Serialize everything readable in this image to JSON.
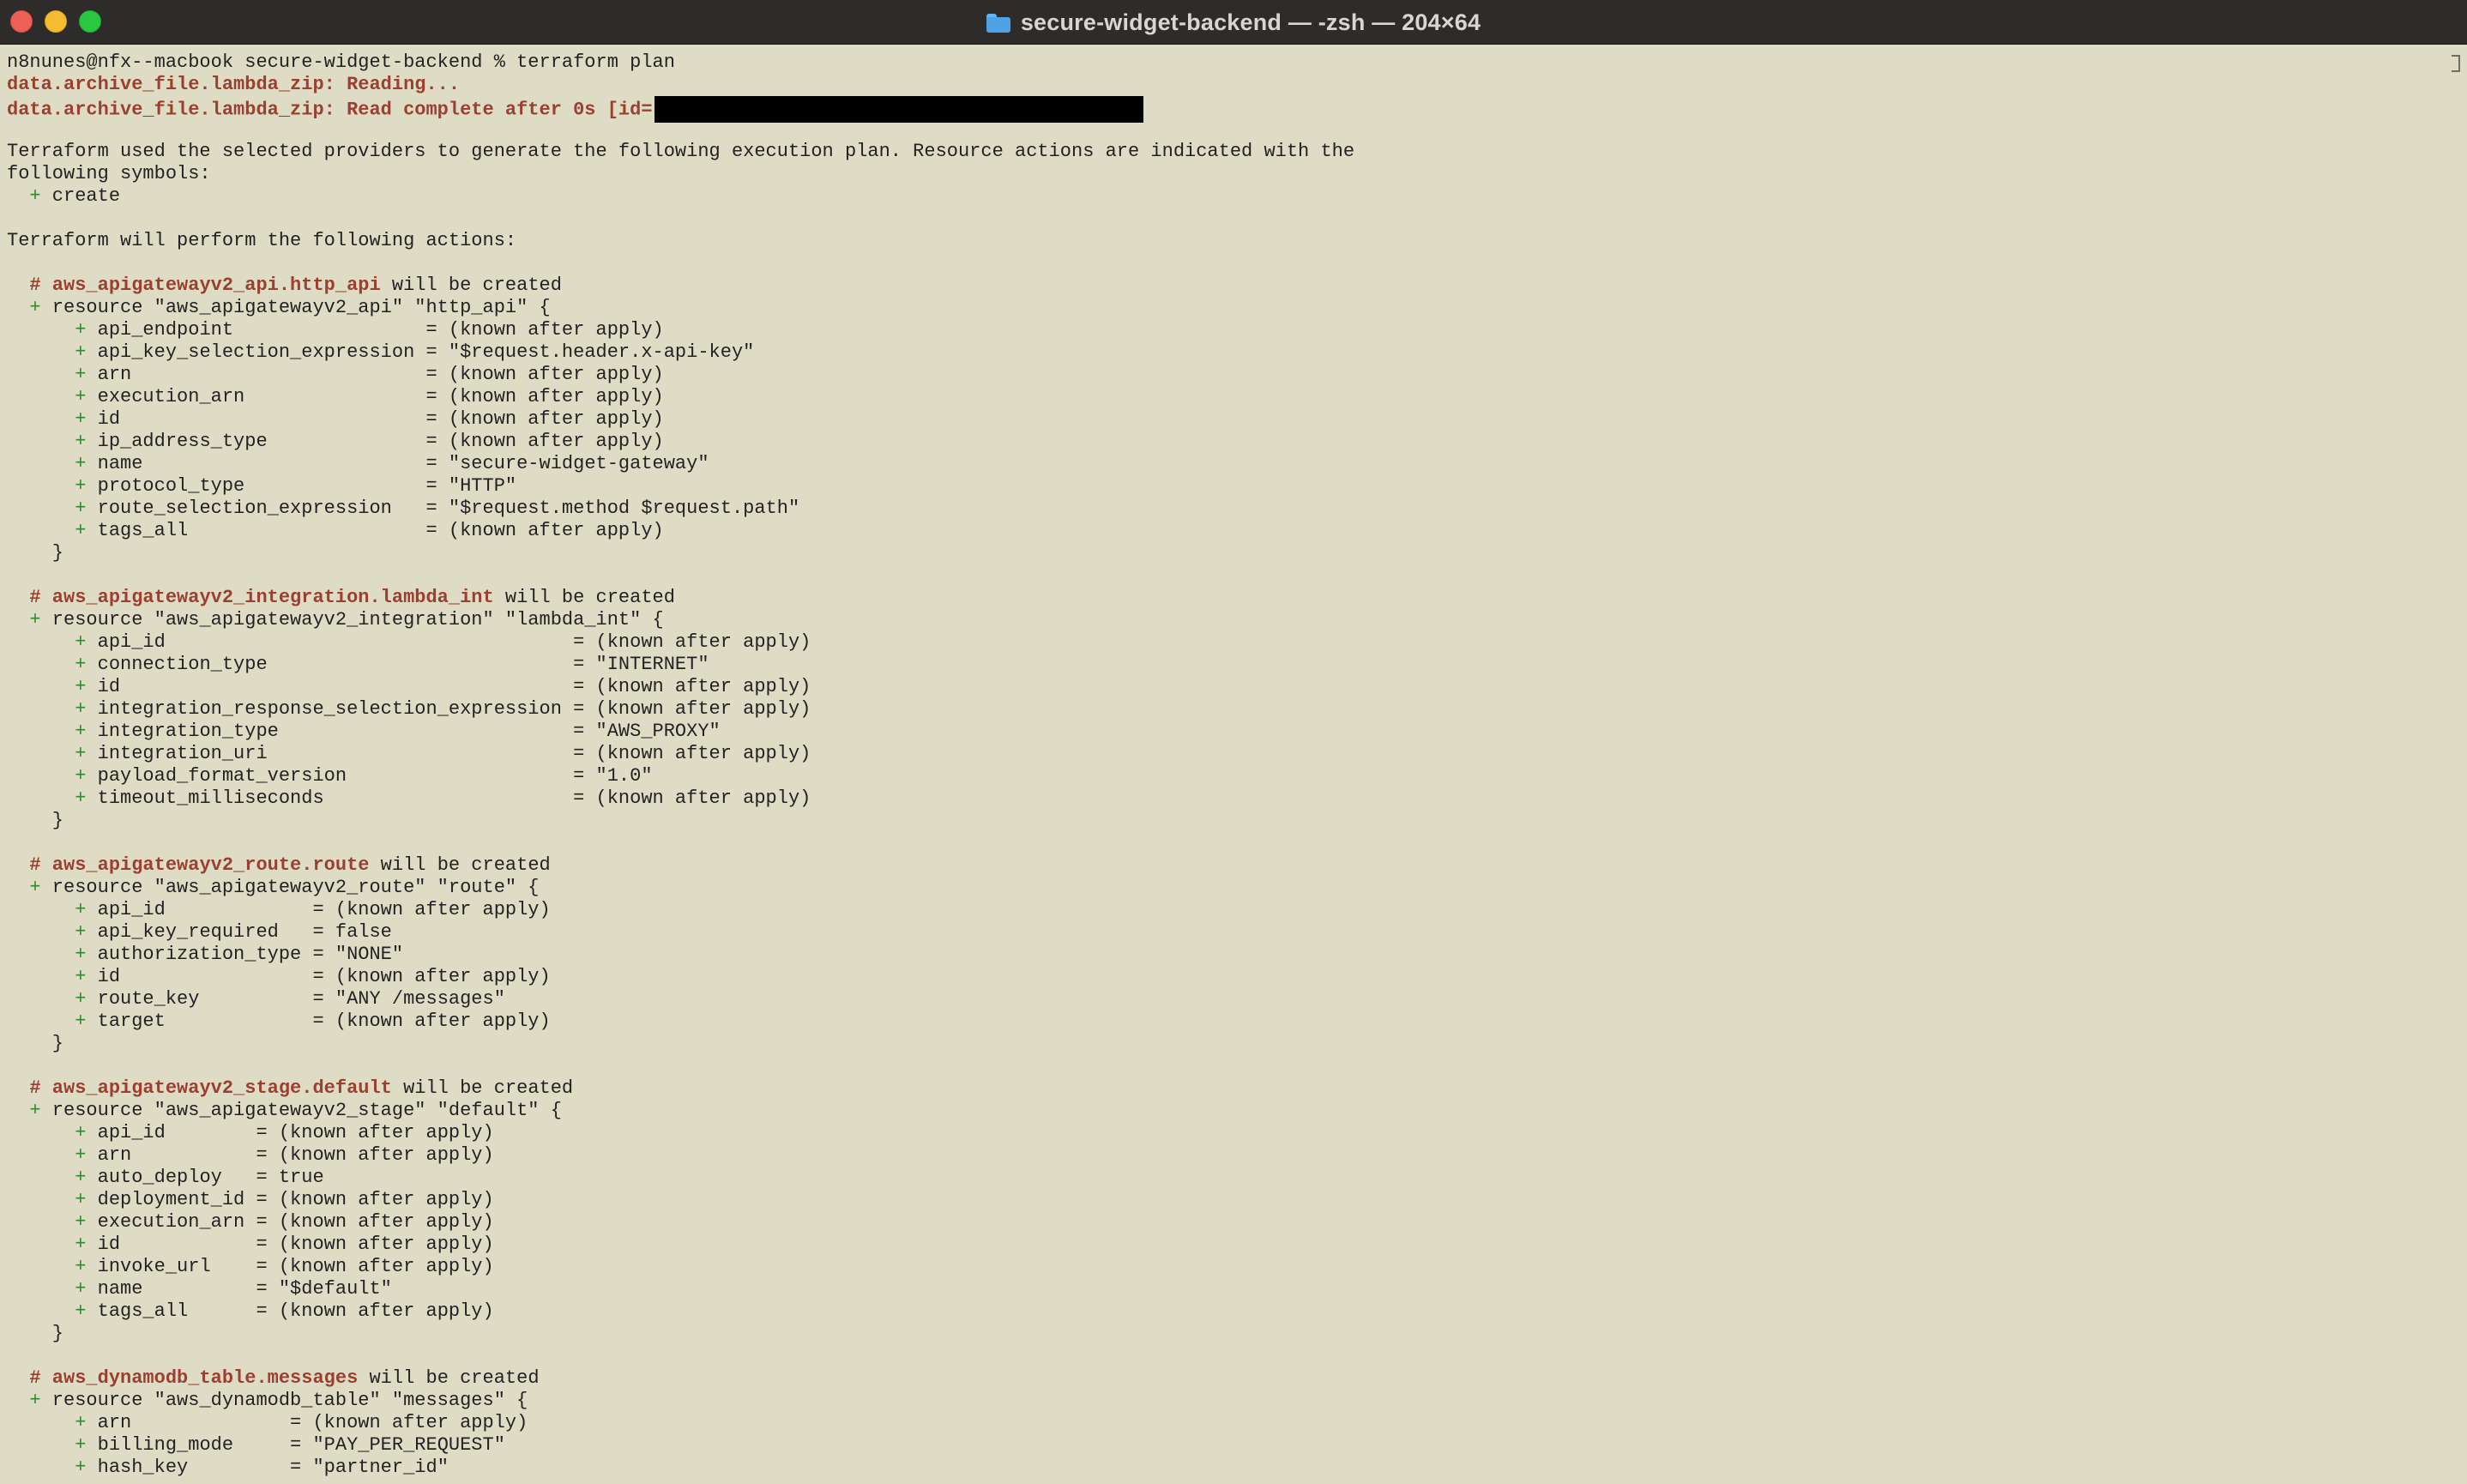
{
  "window": {
    "title": "secure-widget-backend — -zsh — 204×64",
    "icon": "folder-icon"
  },
  "terminal": {
    "lines": [
      {
        "parts": [
          {
            "text": "n8nunes@nfx--macbook secure-widget-backend % terraform plan"
          }
        ]
      },
      {
        "parts": [
          {
            "text": "data.archive_file.lambda_zip: Reading...",
            "class": "bold red"
          }
        ]
      },
      {
        "parts": [
          {
            "text": "data.archive_file.lambda_zip: Read complete after 0s [id=",
            "class": "bold red"
          },
          {
            "type": "redaction"
          }
        ]
      },
      {
        "parts": [
          {
            "text": ""
          }
        ]
      },
      {
        "parts": [
          {
            "text": "Terraform used the selected providers to generate the following execution plan. Resource actions are indicated with the"
          }
        ]
      },
      {
        "parts": [
          {
            "text": "following symbols:"
          }
        ]
      },
      {
        "parts": [
          {
            "text": "  "
          },
          {
            "text": "+",
            "class": "green"
          },
          {
            "text": " create"
          }
        ]
      },
      {
        "parts": [
          {
            "text": ""
          }
        ]
      },
      {
        "parts": [
          {
            "text": "Terraform will perform the following actions:"
          }
        ]
      },
      {
        "parts": [
          {
            "text": ""
          }
        ]
      },
      {
        "parts": [
          {
            "text": "  "
          },
          {
            "text": "#",
            "class": "bold red"
          },
          {
            "text": " aws_apigatewayv2_api.http_api",
            "class": "bold red"
          },
          {
            "text": " will be created"
          }
        ]
      },
      {
        "parts": [
          {
            "text": "  "
          },
          {
            "text": "+",
            "class": "green"
          },
          {
            "text": " resource \"aws_apigatewayv2_api\" \"http_api\" {"
          }
        ]
      },
      {
        "parts": [
          {
            "text": "      "
          },
          {
            "text": "+",
            "class": "green"
          },
          {
            "text": " api_endpoint                 = (known after apply)"
          }
        ]
      },
      {
        "parts": [
          {
            "text": "      "
          },
          {
            "text": "+",
            "class": "green"
          },
          {
            "text": " api_key_selection_expression = \"$request.header.x-api-key\""
          }
        ]
      },
      {
        "parts": [
          {
            "text": "      "
          },
          {
            "text": "+",
            "class": "green"
          },
          {
            "text": " arn                          = (known after apply)"
          }
        ]
      },
      {
        "parts": [
          {
            "text": "      "
          },
          {
            "text": "+",
            "class": "green"
          },
          {
            "text": " execution_arn                = (known after apply)"
          }
        ]
      },
      {
        "parts": [
          {
            "text": "      "
          },
          {
            "text": "+",
            "class": "green"
          },
          {
            "text": " id                           = (known after apply)"
          }
        ]
      },
      {
        "parts": [
          {
            "text": "      "
          },
          {
            "text": "+",
            "class": "green"
          },
          {
            "text": " ip_address_type              = (known after apply)"
          }
        ]
      },
      {
        "parts": [
          {
            "text": "      "
          },
          {
            "text": "+",
            "class": "green"
          },
          {
            "text": " name                         = \"secure-widget-gateway\""
          }
        ]
      },
      {
        "parts": [
          {
            "text": "      "
          },
          {
            "text": "+",
            "class": "green"
          },
          {
            "text": " protocol_type                = \"HTTP\""
          }
        ]
      },
      {
        "parts": [
          {
            "text": "      "
          },
          {
            "text": "+",
            "class": "green"
          },
          {
            "text": " route_selection_expression   = \"$request.method $request.path\""
          }
        ]
      },
      {
        "parts": [
          {
            "text": "      "
          },
          {
            "text": "+",
            "class": "green"
          },
          {
            "text": " tags_all                     = (known after apply)"
          }
        ]
      },
      {
        "parts": [
          {
            "text": "    }"
          }
        ]
      },
      {
        "parts": [
          {
            "text": ""
          }
        ]
      },
      {
        "parts": [
          {
            "text": "  "
          },
          {
            "text": "#",
            "class": "bold red"
          },
          {
            "text": " aws_apigatewayv2_integration.lambda_int",
            "class": "bold red"
          },
          {
            "text": " will be created"
          }
        ]
      },
      {
        "parts": [
          {
            "text": "  "
          },
          {
            "text": "+",
            "class": "green"
          },
          {
            "text": " resource \"aws_apigatewayv2_integration\" \"lambda_int\" {"
          }
        ]
      },
      {
        "parts": [
          {
            "text": "      "
          },
          {
            "text": "+",
            "class": "green"
          },
          {
            "text": " api_id                                    = (known after apply)"
          }
        ]
      },
      {
        "parts": [
          {
            "text": "      "
          },
          {
            "text": "+",
            "class": "green"
          },
          {
            "text": " connection_type                           = \"INTERNET\""
          }
        ]
      },
      {
        "parts": [
          {
            "text": "      "
          },
          {
            "text": "+",
            "class": "green"
          },
          {
            "text": " id                                        = (known after apply)"
          }
        ]
      },
      {
        "parts": [
          {
            "text": "      "
          },
          {
            "text": "+",
            "class": "green"
          },
          {
            "text": " integration_response_selection_expression = (known after apply)"
          }
        ]
      },
      {
        "parts": [
          {
            "text": "      "
          },
          {
            "text": "+",
            "class": "green"
          },
          {
            "text": " integration_type                          = \"AWS_PROXY\""
          }
        ]
      },
      {
        "parts": [
          {
            "text": "      "
          },
          {
            "text": "+",
            "class": "green"
          },
          {
            "text": " integration_uri                           = (known after apply)"
          }
        ]
      },
      {
        "parts": [
          {
            "text": "      "
          },
          {
            "text": "+",
            "class": "green"
          },
          {
            "text": " payload_format_version                    = \"1.0\""
          }
        ]
      },
      {
        "parts": [
          {
            "text": "      "
          },
          {
            "text": "+",
            "class": "green"
          },
          {
            "text": " timeout_milliseconds                      = (known after apply)"
          }
        ]
      },
      {
        "parts": [
          {
            "text": "    }"
          }
        ]
      },
      {
        "parts": [
          {
            "text": ""
          }
        ]
      },
      {
        "parts": [
          {
            "text": "  "
          },
          {
            "text": "#",
            "class": "bold red"
          },
          {
            "text": " aws_apigatewayv2_route.route",
            "class": "bold red"
          },
          {
            "text": " will be created"
          }
        ]
      },
      {
        "parts": [
          {
            "text": "  "
          },
          {
            "text": "+",
            "class": "green"
          },
          {
            "text": " resource \"aws_apigatewayv2_route\" \"route\" {"
          }
        ]
      },
      {
        "parts": [
          {
            "text": "      "
          },
          {
            "text": "+",
            "class": "green"
          },
          {
            "text": " api_id             = (known after apply)"
          }
        ]
      },
      {
        "parts": [
          {
            "text": "      "
          },
          {
            "text": "+",
            "class": "green"
          },
          {
            "text": " api_key_required   = false"
          }
        ]
      },
      {
        "parts": [
          {
            "text": "      "
          },
          {
            "text": "+",
            "class": "green"
          },
          {
            "text": " authorization_type = \"NONE\""
          }
        ]
      },
      {
        "parts": [
          {
            "text": "      "
          },
          {
            "text": "+",
            "class": "green"
          },
          {
            "text": " id                 = (known after apply)"
          }
        ]
      },
      {
        "parts": [
          {
            "text": "      "
          },
          {
            "text": "+",
            "class": "green"
          },
          {
            "text": " route_key          = \"ANY /messages\""
          }
        ]
      },
      {
        "parts": [
          {
            "text": "      "
          },
          {
            "text": "+",
            "class": "green"
          },
          {
            "text": " target             = (known after apply)"
          }
        ]
      },
      {
        "parts": [
          {
            "text": "    }"
          }
        ]
      },
      {
        "parts": [
          {
            "text": ""
          }
        ]
      },
      {
        "parts": [
          {
            "text": "  "
          },
          {
            "text": "#",
            "class": "bold red"
          },
          {
            "text": " aws_apigatewayv2_stage.default",
            "class": "bold red"
          },
          {
            "text": " will be created"
          }
        ]
      },
      {
        "parts": [
          {
            "text": "  "
          },
          {
            "text": "+",
            "class": "green"
          },
          {
            "text": " resource \"aws_apigatewayv2_stage\" \"default\" {"
          }
        ]
      },
      {
        "parts": [
          {
            "text": "      "
          },
          {
            "text": "+",
            "class": "green"
          },
          {
            "text": " api_id        = (known after apply)"
          }
        ]
      },
      {
        "parts": [
          {
            "text": "      "
          },
          {
            "text": "+",
            "class": "green"
          },
          {
            "text": " arn           = (known after apply)"
          }
        ]
      },
      {
        "parts": [
          {
            "text": "      "
          },
          {
            "text": "+",
            "class": "green"
          },
          {
            "text": " auto_deploy   = true"
          }
        ]
      },
      {
        "parts": [
          {
            "text": "      "
          },
          {
            "text": "+",
            "class": "green"
          },
          {
            "text": " deployment_id = (known after apply)"
          }
        ]
      },
      {
        "parts": [
          {
            "text": "      "
          },
          {
            "text": "+",
            "class": "green"
          },
          {
            "text": " execution_arn = (known after apply)"
          }
        ]
      },
      {
        "parts": [
          {
            "text": "      "
          },
          {
            "text": "+",
            "class": "green"
          },
          {
            "text": " id            = (known after apply)"
          }
        ]
      },
      {
        "parts": [
          {
            "text": "      "
          },
          {
            "text": "+",
            "class": "green"
          },
          {
            "text": " invoke_url    = (known after apply)"
          }
        ]
      },
      {
        "parts": [
          {
            "text": "      "
          },
          {
            "text": "+",
            "class": "green"
          },
          {
            "text": " name          = \"$default\""
          }
        ]
      },
      {
        "parts": [
          {
            "text": "      "
          },
          {
            "text": "+",
            "class": "green"
          },
          {
            "text": " tags_all      = (known after apply)"
          }
        ]
      },
      {
        "parts": [
          {
            "text": "    }"
          }
        ]
      },
      {
        "parts": [
          {
            "text": ""
          }
        ]
      },
      {
        "parts": [
          {
            "text": "  "
          },
          {
            "text": "#",
            "class": "bold red"
          },
          {
            "text": " aws_dynamodb_table.messages",
            "class": "bold red"
          },
          {
            "text": " will be created"
          }
        ]
      },
      {
        "parts": [
          {
            "text": "  "
          },
          {
            "text": "+",
            "class": "green"
          },
          {
            "text": " resource \"aws_dynamodb_table\" \"messages\" {"
          }
        ]
      },
      {
        "parts": [
          {
            "text": "      "
          },
          {
            "text": "+",
            "class": "green"
          },
          {
            "text": " arn              = (known after apply)"
          }
        ]
      },
      {
        "parts": [
          {
            "text": "      "
          },
          {
            "text": "+",
            "class": "green"
          },
          {
            "text": " billing_mode     = \"PAY_PER_REQUEST\""
          }
        ]
      },
      {
        "parts": [
          {
            "text": "      "
          },
          {
            "text": "+",
            "class": "green"
          },
          {
            "text": " hash_key         = \"partner_id\""
          }
        ]
      }
    ]
  },
  "colors": {
    "terminal_background": "#dfdcc6",
    "titlebar_background": "#2d2c2b",
    "plan_red": "#9b3f2f",
    "plan_green": "#2f8c27",
    "redaction": "#000000"
  }
}
